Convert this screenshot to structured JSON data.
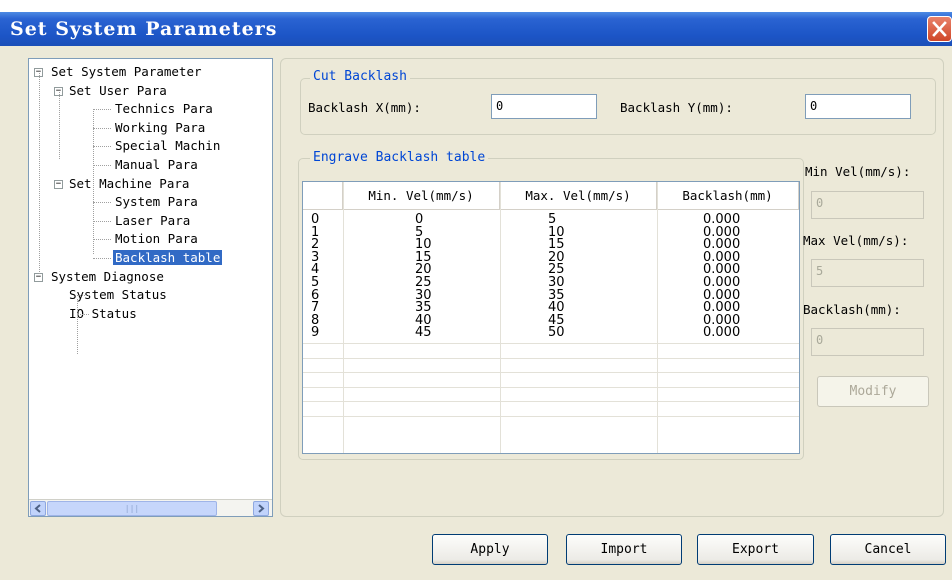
{
  "window": {
    "title": "Set System Parameters"
  },
  "tree": [
    {
      "label": "Set System Parameter",
      "level": 0,
      "expander": "minus"
    },
    {
      "label": "Set User Para",
      "level": 1,
      "expander": "minus"
    },
    {
      "label": "Technics Para",
      "level": 2
    },
    {
      "label": "Working Para",
      "level": 2
    },
    {
      "label": "Special Machin",
      "level": 2
    },
    {
      "label": "Manual Para",
      "level": 2
    },
    {
      "label": "Set Machine Para",
      "level": 1,
      "expander": "minus"
    },
    {
      "label": "System Para",
      "level": 2
    },
    {
      "label": "Laser Para",
      "level": 2
    },
    {
      "label": "Motion Para",
      "level": 2
    },
    {
      "label": "Backlash table",
      "level": 2,
      "selected": true
    },
    {
      "label": "System Diagnose",
      "level": 0,
      "expander": "minus"
    },
    {
      "label": "System Status",
      "level": 1
    },
    {
      "label": "IO Status",
      "level": 1
    }
  ],
  "cut_backlash": {
    "title": "Cut Backlash",
    "x_label": "Backlash X(mm):",
    "x_value": "0",
    "y_label": "Backlash Y(mm):",
    "y_value": "0"
  },
  "engrave": {
    "title": "Engrave Backlash table",
    "columns": [
      "",
      "Min. Vel(mm/s)",
      "Max. Vel(mm/s)",
      "Backlash(mm)"
    ],
    "rows": [
      [
        "0",
        "0",
        "5",
        "0.000"
      ],
      [
        "1",
        "5",
        "10",
        "0.000"
      ],
      [
        "2",
        "10",
        "15",
        "0.000"
      ],
      [
        "3",
        "15",
        "20",
        "0.000"
      ],
      [
        "4",
        "20",
        "25",
        "0.000"
      ],
      [
        "5",
        "25",
        "30",
        "0.000"
      ],
      [
        "6",
        "30",
        "35",
        "0.000"
      ],
      [
        "7",
        "35",
        "40",
        "0.000"
      ],
      [
        "8",
        "40",
        "45",
        "0.000"
      ],
      [
        "9",
        "45",
        "50",
        "0.000"
      ]
    ]
  },
  "side_fields": {
    "min_vel_label": "Min Vel(mm/s):",
    "min_vel_value": "0",
    "max_vel_label": "Max Vel(mm/s):",
    "max_vel_value": "5",
    "backlash_label": "Backlash(mm):",
    "backlash_value": "0",
    "modify_label": "Modify"
  },
  "buttons": {
    "apply": "Apply",
    "import": "Import",
    "export": "Export",
    "cancel": "Cancel"
  },
  "icons": {
    "close": "close-icon",
    "scroll_left": "arrow-left-icon",
    "scroll_right": "arrow-right-icon"
  },
  "colors": {
    "titlebar": "#2a63d2",
    "close": "#cf4628",
    "group_title": "#0046d5",
    "selection": "#316ac5"
  }
}
